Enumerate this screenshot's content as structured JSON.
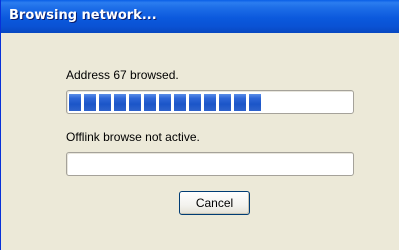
{
  "window": {
    "title": "Browsing network..."
  },
  "status": {
    "address_text": "Address 67 browsed.",
    "offlink_text": "Offlink browse not active."
  },
  "progress": {
    "primary_fraction": 0.68,
    "secondary_fraction": 0.0
  },
  "buttons": {
    "cancel_label": "Cancel"
  },
  "colors": {
    "titlebar": "#0a52d4",
    "progress_fill": "#2e66d6",
    "window_bg": "#ece9d8"
  }
}
